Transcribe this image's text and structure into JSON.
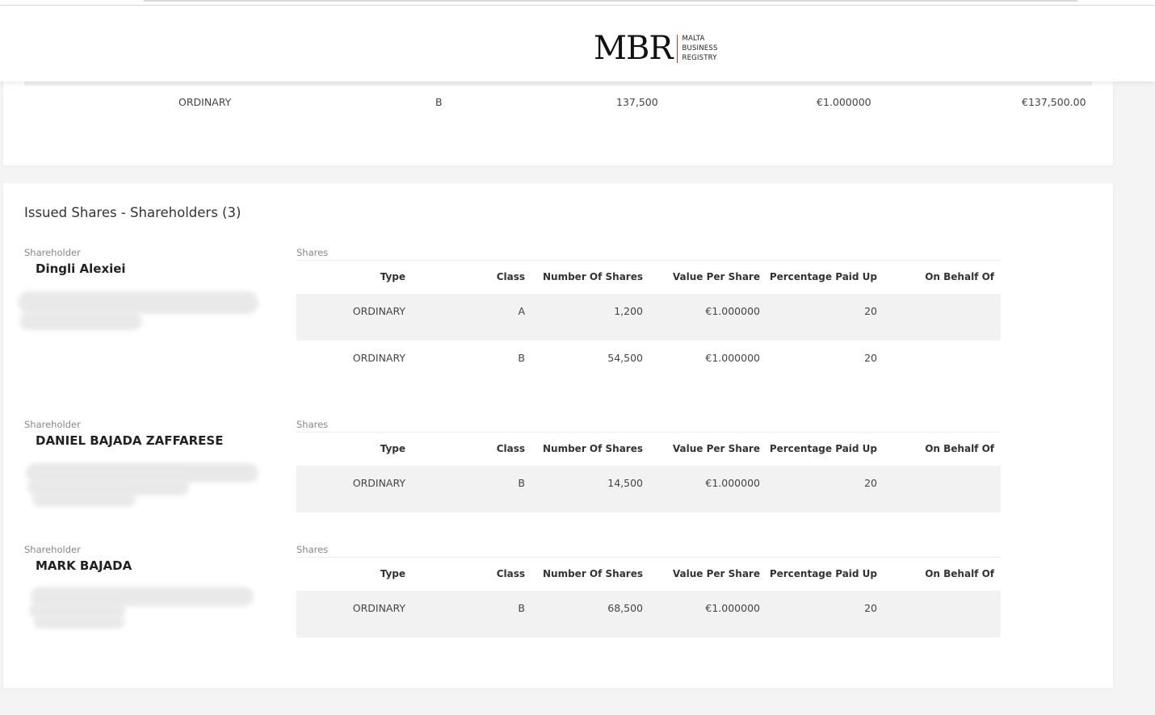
{
  "brand": {
    "logo_text": "MBR",
    "logo_sub": [
      "MALTA",
      "BUSINESS",
      "REGISTRY"
    ],
    "accent": "#c0392b"
  },
  "top_row": {
    "type": "ORDINARY",
    "class": "B",
    "number": "137,500",
    "value": "€1.000000",
    "total": "€137,500.00"
  },
  "section": {
    "title": "Issued Shares - Shareholders (3)"
  },
  "labels": {
    "shareholder": "Shareholder",
    "shares": "Shares"
  },
  "columns": [
    "Type",
    "Class",
    "Number Of Shares",
    "Value Per Share",
    "Percentage Paid Up",
    "On Behalf Of"
  ],
  "shareholders": [
    {
      "name": "Dingli Alexiei",
      "rows": [
        {
          "type": "ORDINARY",
          "class": "A",
          "number": "1,200",
          "value": "€1.000000",
          "pct": "20",
          "behalf": ""
        },
        {
          "type": "ORDINARY",
          "class": "B",
          "number": "54,500",
          "value": "€1.000000",
          "pct": "20",
          "behalf": ""
        }
      ]
    },
    {
      "name": "DANIEL BAJADA ZAFFARESE",
      "rows": [
        {
          "type": "ORDINARY",
          "class": "B",
          "number": "14,500",
          "value": "€1.000000",
          "pct": "20",
          "behalf": ""
        }
      ]
    },
    {
      "name": "MARK BAJADA",
      "rows": [
        {
          "type": "ORDINARY",
          "class": "B",
          "number": "68,500",
          "value": "€1.000000",
          "pct": "20",
          "behalf": ""
        }
      ]
    }
  ]
}
